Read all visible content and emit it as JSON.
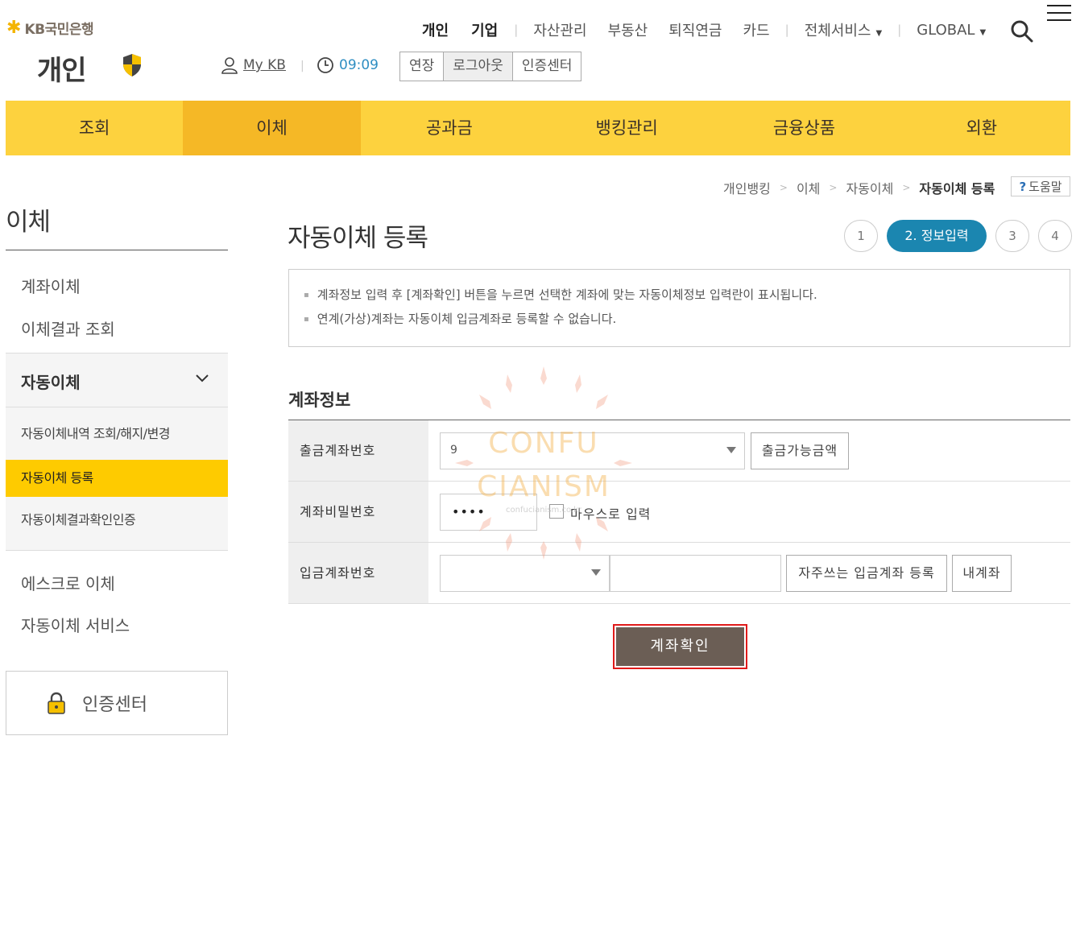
{
  "brand": {
    "logo_text": "KB국민은행",
    "section": "개인"
  },
  "top_nav": {
    "items": [
      "개인",
      "기업",
      "자산관리",
      "부동산",
      "퇴직연금",
      "카드",
      "전체서비스",
      "GLOBAL"
    ]
  },
  "utility": {
    "mykb": "My KB",
    "timer": "09:09",
    "buttons": [
      "연장",
      "로그아웃",
      "인증센터"
    ]
  },
  "gnb": {
    "items": [
      "조회",
      "이체",
      "공과금",
      "뱅킹관리",
      "금융상품",
      "외환"
    ],
    "active_index": 1
  },
  "breadcrumb": {
    "items": [
      "개인뱅킹",
      "이체",
      "자동이체"
    ],
    "current": "자동이체 등록",
    "help": "도움말"
  },
  "sidebar": {
    "title": "이체",
    "items_top": [
      "계좌이체",
      "이체결과 조회"
    ],
    "group": {
      "label": "자동이체",
      "sub_items": [
        "자동이체내역 조회/해지/변경",
        "자동이체 등록",
        "자동이체결과확인인증"
      ],
      "active_index": 1
    },
    "items_bottom": [
      "에스크로 이체",
      "자동이체 서비스"
    ],
    "cert_center": "인증센터"
  },
  "main": {
    "title": "자동이체 등록",
    "steps": [
      "1",
      "2. 정보입력",
      "3",
      "4"
    ],
    "active_step": 2,
    "notices": [
      "계좌정보 입력 후 [계좌확인] 버튼을 누르면 선택한 계좌에 맞는 자동이체정보 입력란이 표시됩니다.",
      "연계(가상)계좌는 자동이체 입금계좌로 등록할 수 없습니다."
    ],
    "section_title": "계좌정보",
    "form": {
      "withdraw_label": "출금계좌번호",
      "withdraw_value": "9",
      "balance_button": "출금가능금액",
      "password_label": "계좌비밀번호",
      "password_value": "••••",
      "mouse_input_label": "마우스로 입력",
      "deposit_label": "입금계좌번호",
      "deposit_bank_value": "",
      "deposit_account_value": "",
      "favorite_button": "자주쓰는 입금계좌 등록",
      "my_account_button": "내계좌"
    },
    "confirm_button": "계좌확인"
  },
  "watermark": {
    "line1": "CONFU",
    "line2": "CIANISM",
    "small": "confucianism.co.kr"
  },
  "colors": {
    "gnb": "#fdd23e",
    "gnb_active": "#f5b826",
    "sidebar_active": "#fecb00",
    "step_active": "#1b86b0",
    "confirm_bg": "#6b5e55",
    "highlight_border": "#e01a1a"
  }
}
